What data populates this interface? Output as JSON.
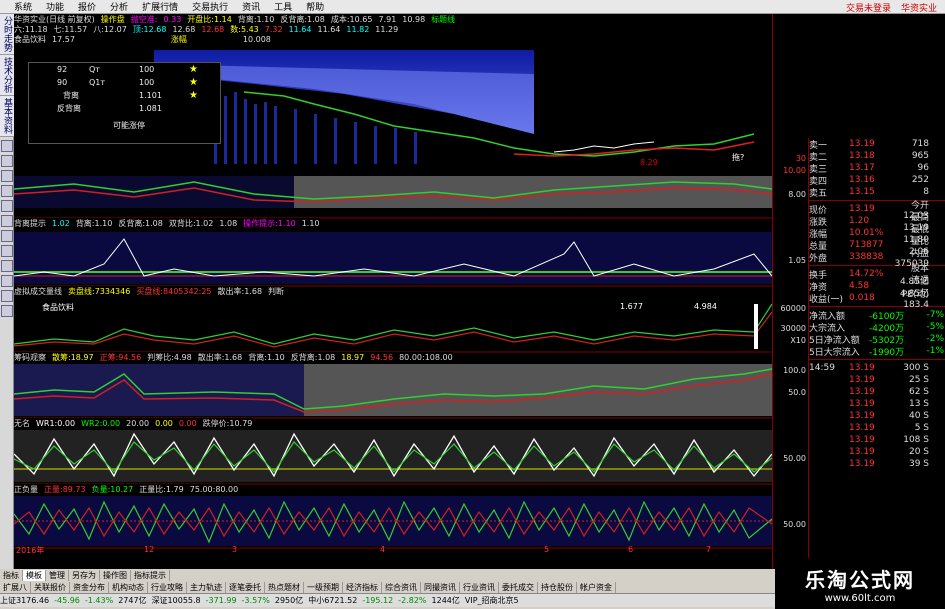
{
  "menu": {
    "items": [
      "系统",
      "功能",
      "报价",
      "分析",
      "扩展行情",
      "交易执行",
      "资讯",
      "工具",
      "帮助"
    ],
    "right": [
      "交易未登录",
      "华资实业"
    ]
  },
  "left_toolbar": {
    "labels": [
      "分时走势",
      "技术分析",
      "基本资料"
    ]
  },
  "top_band": {
    "row1": [
      "华资实业(日线 前复权)",
      "操作盘",
      "抛空准:",
      "0.33",
      "开盘比:1.14",
      "背离:1.10",
      "反背离:1.08",
      "成本:10.65",
      "7.91",
      "10.98",
      "标题线"
    ],
    "row2": [
      "六:11.18",
      "七:11.57",
      "八:12.07",
      "顶:12.68",
      "12.68",
      "12.68",
      "数:5.43",
      "7.32",
      "11.64",
      "11.64",
      "11.82",
      "11.29"
    ]
  },
  "main_pane": {
    "label": "食品饮料",
    "value_a": "17.57",
    "label_b": "涨幅",
    "value_b": "10.008",
    "marker": "8.29",
    "annot": "拖?"
  },
  "info_box": {
    "rows": [
      {
        "a": "92",
        "b": "Qт",
        "c": "100"
      },
      {
        "a": "90",
        "b": "Q1т",
        "c": "100"
      },
      {
        "a": "背离",
        "b": "",
        "c": "1.101"
      },
      {
        "a": "反背离",
        "b": "",
        "c": "1.081"
      }
    ],
    "footer": "可能涨停"
  },
  "pane2": {
    "items": [
      "背离提示",
      "1.02",
      "背离:1.10",
      "反背离:1.08",
      "双背比:1.02",
      "1.08",
      "操作提示:1.10",
      "1.10"
    ]
  },
  "pane3": {
    "items": [
      "虚拟成交量线",
      "卖盘线:7334346",
      "买盘线:8405342:25",
      "散出率:1.68",
      "判断"
    ],
    "label": "食品饮料",
    "v1": "1.677",
    "v2": "4.984"
  },
  "pane4": {
    "items": [
      "筹码观察",
      "散筹:18.97",
      "正筹:94.56",
      "判筹比:4.98",
      "散出率:1.68",
      "背离:1.10",
      "反背离:1.08",
      "18.97",
      "94.56",
      "80.00:108.00"
    ]
  },
  "pane5": {
    "items": [
      "无名",
      "WR1:0.00",
      "WR2:0.00",
      "20.00",
      "0.00",
      "0.00",
      "跌停价:10.79"
    ]
  },
  "pane6": {
    "items": [
      "正负量",
      "正量:89.73",
      "负量:10.27",
      "正量比:1.79",
      "75.00:80.00"
    ]
  },
  "yaxis": {
    "labels": [
      "30",
      "10.00",
      "8.00",
      "1.05",
      "60000",
      "30000",
      "X10",
      "100.0",
      "50.0",
      "50.00",
      "50.00",
      "50.00"
    ]
  },
  "xaxis": {
    "labels": [
      "2016年",
      "12",
      "3",
      "4",
      "5",
      "6",
      "7"
    ]
  },
  "quote": {
    "asks": [
      {
        "a": "卖一",
        "b": "13.19",
        "c": "718"
      },
      {
        "a": "卖二",
        "b": "13.18",
        "c": "965"
      },
      {
        "a": "卖三",
        "b": "13.17",
        "c": "96"
      },
      {
        "a": "卖四",
        "b": "13.16",
        "c": "252"
      },
      {
        "a": "卖五",
        "b": "13.15",
        "c": "8"
      }
    ],
    "stats": [
      {
        "a": "现价",
        "b": "13.19",
        "c": "今开 12.03"
      },
      {
        "a": "涨跌",
        "b": "1.20",
        "c": "最高 13.19"
      },
      {
        "a": "涨幅",
        "b": "10.01%",
        "c": "最低 11.80"
      },
      {
        "a": "总量",
        "b": "713877",
        "c": "量比 2.06"
      },
      {
        "a": "外盘",
        "b": "338838",
        "c": "内盘 375039"
      }
    ],
    "extra": [
      {
        "a": "换手",
        "b": "14.72%",
        "c": "股本 4.85亿"
      },
      {
        "a": "净资",
        "b": "4.58",
        "c": "流通 4.85亿"
      },
      {
        "a": "收益(一)",
        "b": "0.018",
        "c": "PE(动) 183.4"
      }
    ],
    "flows": [
      {
        "a": "净流入额",
        "b": "-6100万",
        "c": "-7%"
      },
      {
        "a": "大宗流入",
        "b": "-4200万",
        "c": "-5%"
      },
      {
        "a": "5日净流入额",
        "b": "-5302万",
        "c": "-2%"
      },
      {
        "a": "5日大宗流入",
        "b": "-1990万",
        "c": "-1%"
      }
    ],
    "ticks": [
      {
        "a": "14:59",
        "b": "13.19",
        "c": "300 S"
      },
      {
        "a": "",
        "b": "13.19",
        "c": "25 S"
      },
      {
        "a": "",
        "b": "13.19",
        "c": "62 S"
      },
      {
        "a": "",
        "b": "13.19",
        "c": "13 S"
      },
      {
        "a": "",
        "b": "13.19",
        "c": "40 S"
      },
      {
        "a": "",
        "b": "13.19",
        "c": "5 S"
      },
      {
        "a": "",
        "b": "13.19",
        "c": "108 S"
      },
      {
        "a": "",
        "b": "13.19",
        "c": "20 S"
      },
      {
        "a": "",
        "b": "13.19",
        "c": "39 S"
      }
    ]
  },
  "bottom": {
    "tabs1": [
      "指标",
      "模板",
      "管理",
      "另存为",
      "操作图",
      "指标提示"
    ],
    "tabs2": [
      "扩展八",
      "关联报价",
      "资金分布",
      "机构动态",
      "行业攻略",
      "主力轨迹",
      "逐笔委托",
      "热点题材",
      "一级预期",
      "经济指标",
      "综合资讯",
      "同撮资讯",
      "行业资讯",
      "委托成交",
      "持仓股份",
      "帐户资金"
    ],
    "status": [
      "上证3176.46",
      "-45.96",
      "-1.43%",
      "2747亿",
      "深证10055.8",
      "-371.99",
      "-3.57%",
      "2950亿",
      "中小6721.52",
      "-195.12",
      "-2.82%",
      "1244亿",
      "VIP_招商北京5"
    ]
  },
  "logo": {
    "title": "乐淘公式网",
    "url": "www.60lt.com"
  }
}
